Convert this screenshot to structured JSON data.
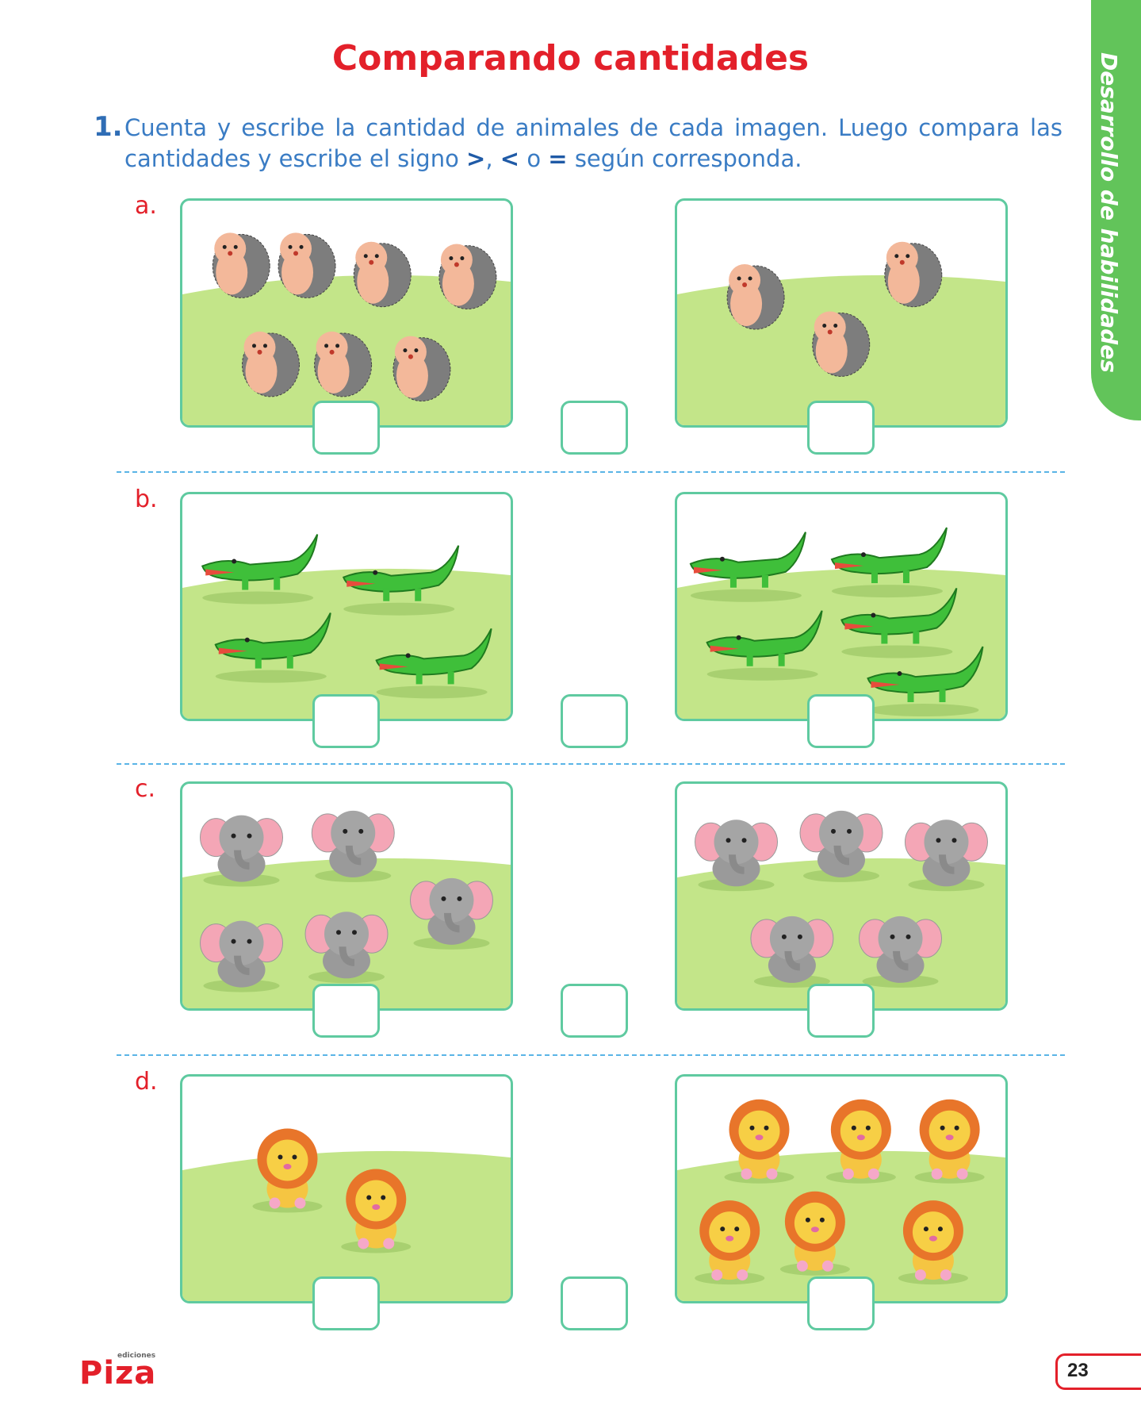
{
  "title": "Comparando cantidades",
  "side_tab": "Desarrollo de habilidades",
  "instruction": {
    "number": "1.",
    "text_1": "Cuenta y escribe la cantidad de animales de cada imagen. Luego compara las cantidades y escribe el signo ",
    "sign_gt": ">",
    "sep_1": ", ",
    "sign_lt": "<",
    "sep_2": " o ",
    "sign_eq": "=",
    "text_2": " según corresponda."
  },
  "exercises": [
    {
      "label": "a.",
      "animal": "hedgehog-icon",
      "left_answer": "",
      "sign_answer": "",
      "right_answer": ""
    },
    {
      "label": "b.",
      "animal": "crocodile-icon",
      "left_answer": "",
      "sign_answer": "",
      "right_answer": ""
    },
    {
      "label": "c.",
      "animal": "elephant-icon",
      "left_answer": "",
      "sign_answer": "",
      "right_answer": ""
    },
    {
      "label": "d.",
      "animal": "lion-icon",
      "left_answer": "",
      "sign_answer": "",
      "right_answer": ""
    }
  ],
  "footer": {
    "logo": "Piza",
    "logo_sub": "ediciones",
    "page_number": "23"
  },
  "colors": {
    "title": "#e3202a",
    "instruction": "#3a7cc4",
    "tab": "#62c45a",
    "grass": "#c3e589",
    "border": "#5fcaa0",
    "dash": "#5ab4e6"
  }
}
